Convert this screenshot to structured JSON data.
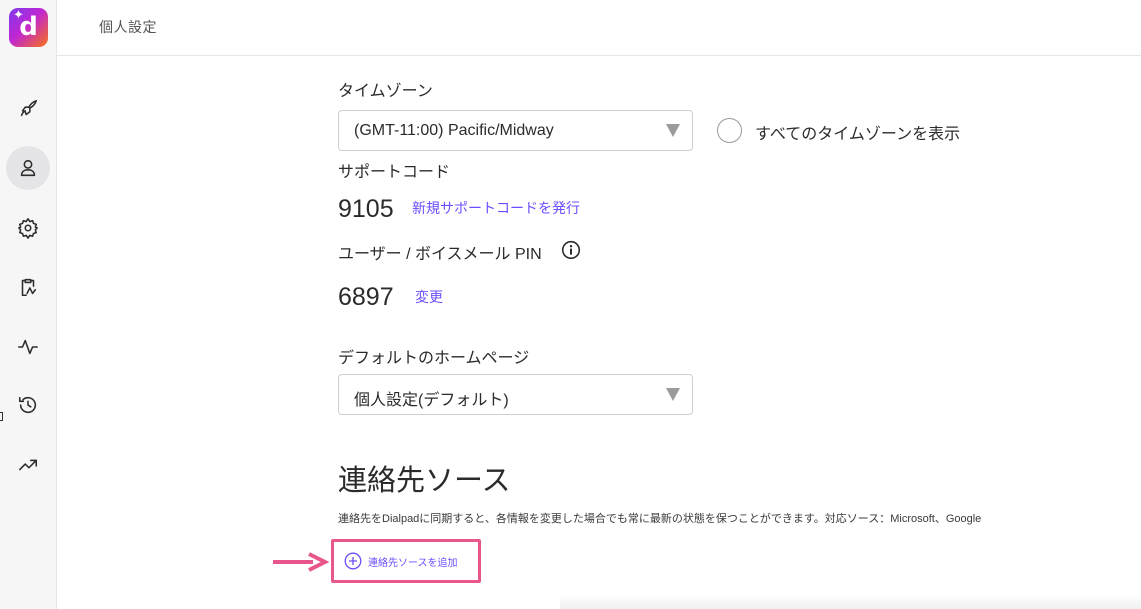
{
  "header": {
    "title": "個人設定"
  },
  "sidebar": {
    "logo_letter": "d",
    "items": [
      {
        "name": "rocket-icon"
      },
      {
        "name": "person-icon"
      },
      {
        "name": "gear-icon"
      },
      {
        "name": "clipboard-icon"
      },
      {
        "name": "activity-icon"
      },
      {
        "name": "history-icon"
      },
      {
        "name": "trending-up-icon"
      }
    ]
  },
  "timezone": {
    "label": "タイムゾーン",
    "selected": "(GMT-11:00) Pacific/Midway",
    "show_all_label": "すべてのタイムゾーンを表示"
  },
  "support_code": {
    "label": "サポートコード",
    "value": "9105",
    "action": "新規サポートコードを発行"
  },
  "pin": {
    "label": "ユーザー / ボイスメール PIN",
    "value": "6897",
    "action": "変更"
  },
  "homepage": {
    "label": "デフォルトのホームページ",
    "selected": "個人設定(デフォルト)"
  },
  "contact_sources": {
    "title": "連絡先ソース",
    "description": "連絡先をDialpadに同期すると、各情報を変更した場合でも常に最新の状態を保つことができます。対応ソース：Microsoft、Google",
    "add_label": "連絡先ソースを追加"
  },
  "colors": {
    "accent": "#6b4eff",
    "highlight": "#e8578b"
  }
}
